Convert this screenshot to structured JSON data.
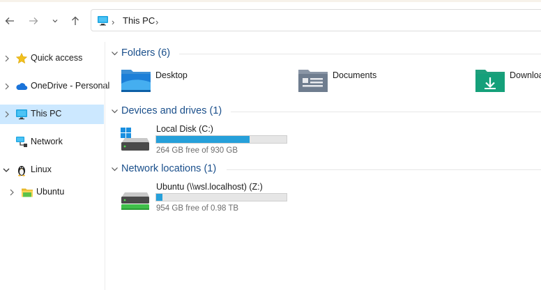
{
  "toolbar": {
    "back_icon": "back-arrow-icon",
    "forward_icon": "forward-arrow-icon",
    "recent_icon": "chevron-down-icon",
    "up_icon": "up-arrow-icon"
  },
  "address": {
    "location": "This PC",
    "icon": "computer-icon"
  },
  "sidebar": {
    "items": [
      {
        "label": "Quick access",
        "icon": "star-icon"
      },
      {
        "label": "OneDrive - Personal",
        "icon": "cloud-icon"
      },
      {
        "label": "This PC",
        "icon": "computer-icon",
        "selected": true
      },
      {
        "label": "Network",
        "icon": "network-icon"
      },
      {
        "label": "Linux",
        "icon": "penguin-icon",
        "expanded": true
      },
      {
        "label": "Ubuntu",
        "icon": "folder-icon"
      }
    ]
  },
  "groups": {
    "folders": {
      "title": "Folders (6)",
      "items": [
        {
          "label": "Desktop",
          "icon": "desktop-folder-icon"
        },
        {
          "label": "Documents",
          "icon": "documents-folder-icon"
        },
        {
          "label": "Downloads",
          "icon": "downloads-folder-icon"
        }
      ]
    },
    "devices": {
      "title": "Devices and drives (1)",
      "drive": {
        "name": "Local Disk (C:)",
        "free": "264 GB free of 930 GB",
        "used_fraction": 0.716,
        "icon": "windows-drive-icon"
      }
    },
    "network": {
      "title": "Network locations (1)",
      "drive": {
        "name": "Ubuntu (\\\\wsl.localhost) (Z:)",
        "free": "954 GB free of 0.98 TB",
        "used_fraction": 0.049,
        "icon": "network-drive-icon"
      }
    }
  },
  "colors": {
    "selected_bg": "#cce8ff",
    "group_title": "#1a4f8b",
    "bar_fill": "#26a0da"
  }
}
